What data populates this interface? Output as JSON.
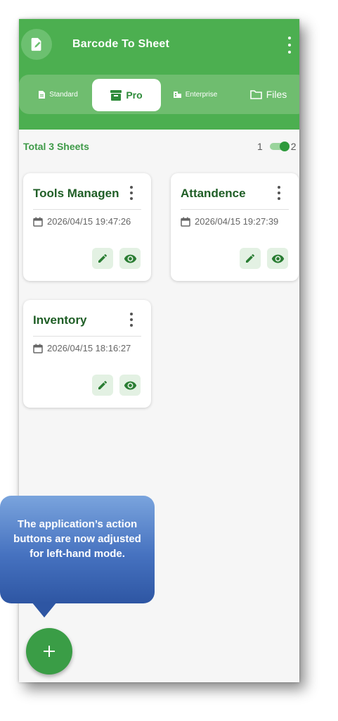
{
  "app": {
    "title": "Barcode To Sheet"
  },
  "tabs": [
    {
      "label": "Standard",
      "icon": "document-icon",
      "selected": false
    },
    {
      "label": "Pro",
      "icon": "archive-icon",
      "selected": true
    },
    {
      "label": "Enterprise",
      "icon": "building-icon",
      "selected": false
    },
    {
      "label": "Files",
      "icon": "folder-icon",
      "selected": false
    }
  ],
  "summary": {
    "text": "Total 3 Sheets",
    "toggle_left": "1",
    "toggle_right": "2",
    "toggle_on": true
  },
  "sheets": [
    {
      "title": "Tools Managen",
      "date": "2026/04/15 19:47:26"
    },
    {
      "title": "Attandence",
      "date": "2026/04/15 19:27:39"
    },
    {
      "title": "Inventory",
      "date": "2026/04/15 18:16:27"
    }
  ],
  "tooltip": {
    "text": "The application’s action buttons are now adjusted for left-hand mode."
  },
  "fab": {
    "label": "+"
  },
  "colors": {
    "primary": "#4caf50",
    "tab_bar": "#6fbd6f",
    "accent_dark": "#2e8b3a",
    "card_title": "#1f5e26",
    "tooltip": "#4672c0"
  }
}
